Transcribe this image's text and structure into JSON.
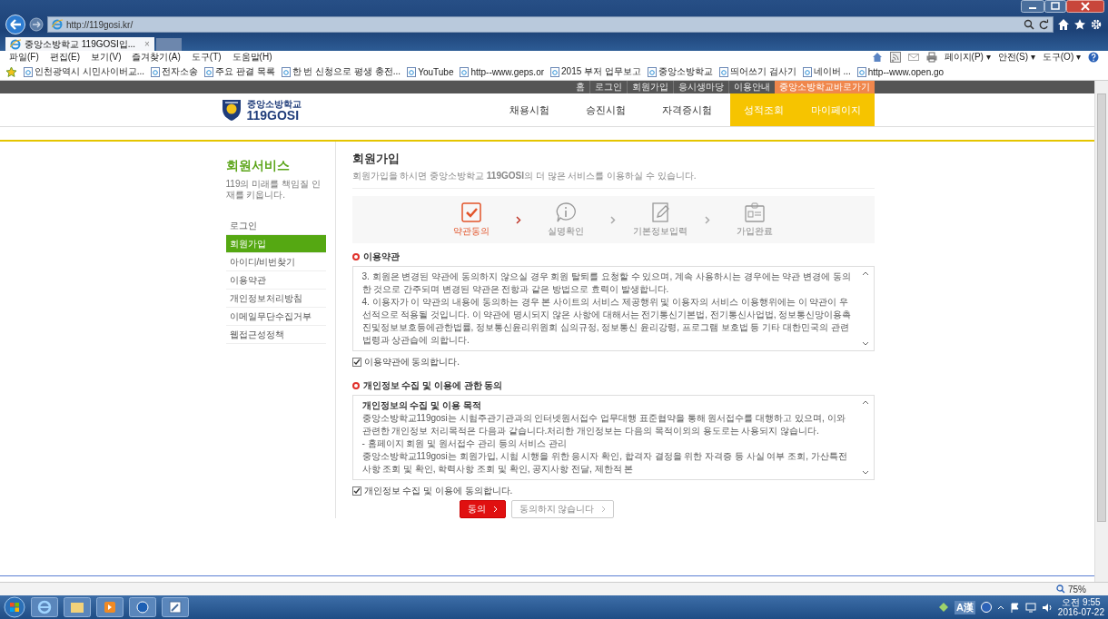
{
  "browser": {
    "address": "http://119gosi.kr/",
    "tab": {
      "title": "중앙소방학교 119GOSI입...",
      "close": "×"
    },
    "menu": [
      "파일(F)",
      "편집(E)",
      "보기(V)",
      "즐겨찾기(A)",
      "도구(T)",
      "도움말(H)"
    ],
    "command_bar": [
      "페이지(P) ▾",
      "안전(S) ▾",
      "도구(O) ▾"
    ],
    "favorites": [
      "인천광역시 시민사이버교...",
      "전자소송",
      "주요 판결 목록",
      "한 번 신청으로 평생 충전...",
      "YouTube",
      "http--www.geps.or",
      "2015 부저 업무보고",
      "중앙소방학교",
      "띄어쓰기 검사기",
      "네이버 ...",
      "http--www.open.go"
    ]
  },
  "site": {
    "top_links": [
      {
        "label": "홈",
        "highlighted": false
      },
      {
        "label": "로그인",
        "highlighted": false
      },
      {
        "label": "회원가입",
        "highlighted": false
      },
      {
        "label": "응시생마당",
        "highlighted": false
      },
      {
        "label": "이용안내",
        "highlighted": false
      },
      {
        "label": "중앙소방학교바로가기",
        "highlighted": true
      }
    ],
    "logo": {
      "line1": "중앙소방학교",
      "line2": "119GOSI"
    },
    "nav": [
      {
        "label": "채용시험",
        "highlighted": false
      },
      {
        "label": "승진시험",
        "highlighted": false
      },
      {
        "label": "자격증시험",
        "highlighted": false
      },
      {
        "label": "성적조회",
        "highlighted": true
      },
      {
        "label": "마이페이지",
        "highlighted": true
      }
    ]
  },
  "sidebar": {
    "title": "회원서비스",
    "subtitle": "119의 미래를 책임질 인재를 키웁니다.",
    "items": [
      {
        "label": "로그인",
        "selected": false
      },
      {
        "label": "회원가입",
        "selected": true
      },
      {
        "label": "아이디/비번찾기",
        "selected": false
      },
      {
        "label": "이용약관",
        "selected": false
      },
      {
        "label": "개인정보처리방침",
        "selected": false
      },
      {
        "label": "이메일무단수집거부",
        "selected": false
      },
      {
        "label": "웹접근성정책",
        "selected": false
      }
    ]
  },
  "main": {
    "title": "회원가입",
    "description": "회원가입을 하시면 중앙소방학교 **119GOSI**의 더 많은 서비스를 이용하실 수 있습니다.",
    "steps": [
      {
        "label": "약관동의",
        "kind": "check",
        "active": true
      },
      {
        "label": "실명확인",
        "kind": "info",
        "active": false
      },
      {
        "label": "기본정보입력",
        "kind": "edit",
        "active": false
      },
      {
        "label": "가입완료",
        "kind": "card",
        "active": false
      }
    ],
    "terms": {
      "heading": "이용약관",
      "paragraphs": [
        "3. 회원은 변경된 약관에 동의하지 않으실 경우 회원 탈퇴를 요청할 수 있으며, 계속 사용하시는 경우에는 약관 변경에 동의한 것으로 간주되며 변경된 약관은 전항과 같은 방법으로 효력이 발생합니다.",
        "4. 이용자가 이 약관의 내용에 동의하는 경우 본 사이트의 서비스 제공행위 및 이용자의 서비스 이용행위에는 이 약관이 우선적으로 적용될 것입니다. 이 약관에 명시되지 않은 사항에 대해서는 전기통신기본법, 전기통신사업법, 정보통신망이용촉진및정보보호등에관한법률, 정보통신윤리위원회 심의규정, 정보통신 윤리강령, 프로그램 보호법 등 기타 대한민국의 관련법령과 상관습에 의합니다."
      ],
      "agree": {
        "label": "이용약관에 동의합니다.",
        "checked": true
      }
    },
    "privacy": {
      "heading": "개인정보 수집 및 이용에 관한 동의",
      "title": "개인정보의 수집 및 이용 목적",
      "paragraphs": [
        "중앙소방학교119gosi는 시험주관기관과의 인터넷원서접수 업무대행 표준협약을 통해 원서접수를 대행하고 있으며, 이와 관련한 개인정보 처리목적은 다음과 같습니다.처리한 개인정보는 다음의 목적이외의 용도로는 사용되지 않습니다.",
        "- 홈페이지 회원 및 원서접수 관리 등의 서비스 관리",
        "중앙소방학교119gosi는 회원가입, 시험 시행을 위한 응시자 확인, 합격자 결정을 위한 자격증 등 사실 여부 조회, 가산특전사항 조회 및 확인, 학력사항 조회 및 확인, 공지사항 전달, 제한적 본"
      ],
      "agree": {
        "label": "개인정보 수집 및 이용에 동의합니다.",
        "checked": true
      }
    },
    "buttons": [
      {
        "label": "동의",
        "kind": "primary"
      },
      {
        "label": "동의하지 않습니다",
        "kind": "secondary"
      }
    ]
  },
  "status_bar": {
    "zoom": "75%"
  },
  "taskbar": {
    "ime": "A漢",
    "time": "오전 9:55",
    "date": "2016-07-22"
  }
}
